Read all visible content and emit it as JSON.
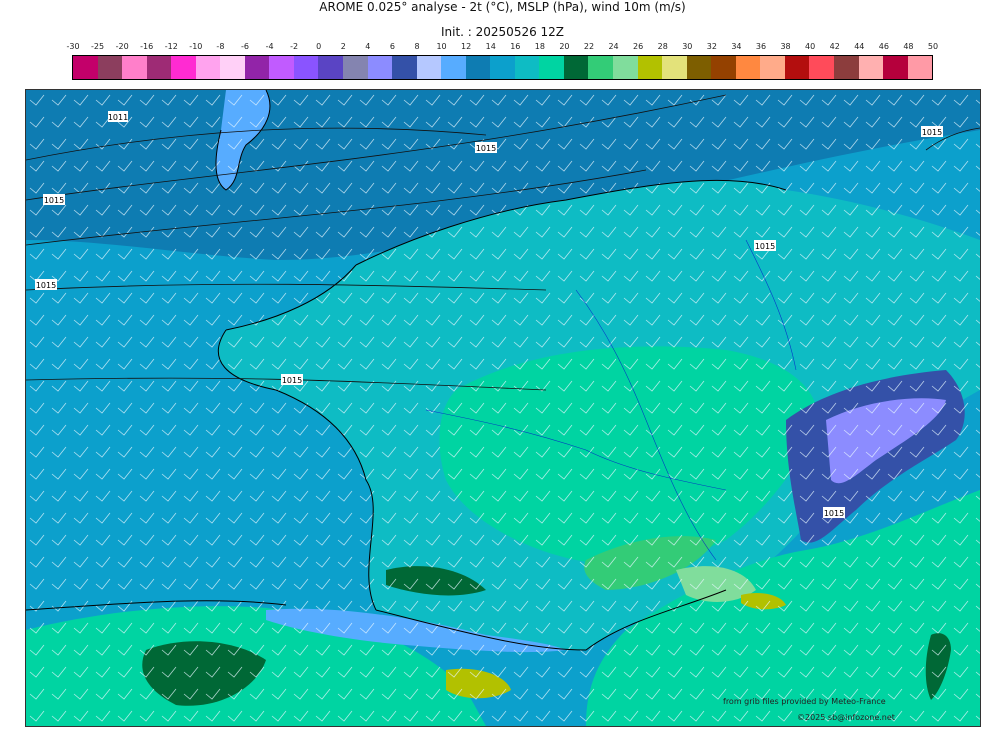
{
  "title": "AROME 0.025° analyse - 2t (°C), MSLP (hPa), wind 10m (m/s)",
  "subtitle": "Init. : 20250526 12Z",
  "scale": {
    "ticks": [
      "-30",
      "-25",
      "-20",
      "-16",
      "-12",
      "-10",
      "-8",
      "-6",
      "-4",
      "-2",
      "0",
      "2",
      "4",
      "6",
      "8",
      "10",
      "12",
      "14",
      "16",
      "18",
      "20",
      "22",
      "24",
      "26",
      "28",
      "30",
      "32",
      "34",
      "36",
      "38",
      "40",
      "42",
      "44",
      "46",
      "48",
      "50"
    ],
    "colors": [
      "#c3006a",
      "#8c3e5e",
      "#ff7fca",
      "#9e2b75",
      "#ff2bd2",
      "#ffa3ee",
      "#ffd0f7",
      "#9224a8",
      "#c15bff",
      "#8a54ff",
      "#5a44c4",
      "#8484b0",
      "#8c8cff",
      "#3451a8",
      "#b5c8ff",
      "#57acff",
      "#0e7cb2",
      "#0ca0cc",
      "#0ebcc4",
      "#00d4a2",
      "#006836",
      "#33cc77",
      "#80dd9c",
      "#b2c100",
      "#e3e27a",
      "#7d5e00",
      "#944100",
      "#ff8840",
      "#ffab8a",
      "#b30e0e",
      "#ff4b5a",
      "#8c3d3d",
      "#ffb0b0",
      "#b5003c",
      "#ff9aa6"
    ]
  },
  "isobar_labels": [
    "1011",
    "1015",
    "1015",
    "1015",
    "1015",
    "1015",
    "1015",
    "1015"
  ],
  "credits": {
    "line1": "from grib files provided by Meteo-France",
    "line2": "©2025 sb@infozone.net"
  }
}
